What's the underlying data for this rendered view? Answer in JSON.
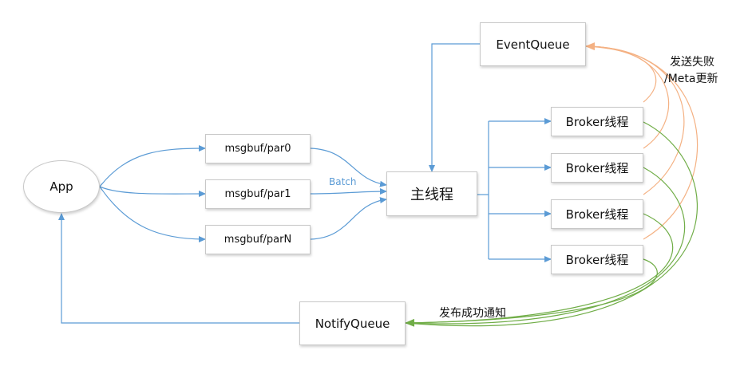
{
  "nodes": {
    "app": "App",
    "buf0": "msgbuf/par0",
    "buf1": "msgbuf/par1",
    "bufN": "msgbuf/parN",
    "main": "主线程",
    "event_queue": "EventQueue",
    "notify_queue": "NotifyQueue",
    "brokers": [
      "Broker线程",
      "Broker线程",
      "Broker线程",
      "Broker线程"
    ]
  },
  "labels": {
    "batch": "Batch",
    "fail_line1": "发送失败",
    "fail_line2": "/Meta更新",
    "success": "发布成功通知"
  },
  "colors": {
    "blue": "#5b9bd5",
    "orange": "#f4b183",
    "green": "#70ad47"
  }
}
